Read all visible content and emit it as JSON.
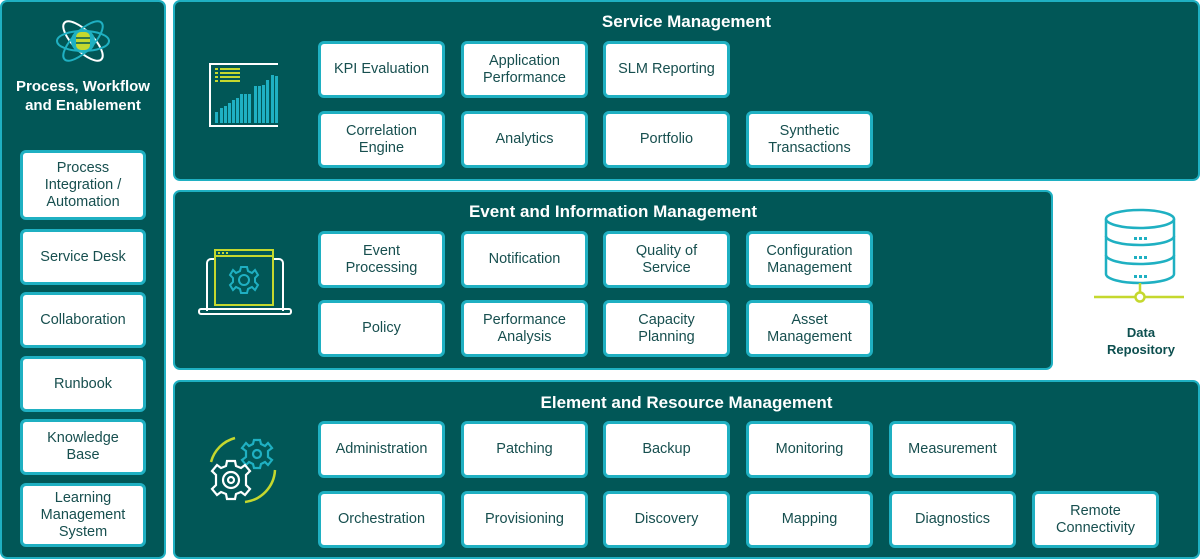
{
  "left_panel": {
    "title": "Process, Workflow\nand Enablement",
    "icon": "atom-database-icon",
    "items": [
      "Process\nIntegration /\nAutomation",
      "Service Desk",
      "Collaboration",
      "Runbook",
      "Knowledge\nBase",
      "Learning\nManagement\nSystem"
    ]
  },
  "service_management": {
    "title": "Service Management",
    "icon": "kpi-bar-chart-icon",
    "row1": [
      "KPI Evaluation",
      "Application\nPerformance",
      "SLM Reporting"
    ],
    "row2": [
      "Correlation\nEngine",
      "Analytics",
      "Portfolio",
      "Synthetic\nTransactions"
    ]
  },
  "event_management": {
    "title": "Event and Information Management",
    "icon": "laptop-gear-icon",
    "row1": [
      "Event\nProcessing",
      "Notification",
      "Quality of\nService",
      "Configuration\nManagement"
    ],
    "row2": [
      "Policy",
      "Performance\nAnalysis",
      "Capacity\nPlanning",
      "Asset\nManagement"
    ]
  },
  "element_management": {
    "title": "Element and Resource Management",
    "icon": "gears-icon",
    "row1": [
      "Administration",
      "Patching",
      "Backup",
      "Monitoring",
      "Measurement"
    ],
    "row2": [
      "Orchestration",
      "Provisioning",
      "Discovery",
      "Mapping",
      "Diagnostics",
      "Remote\nConnectivity"
    ]
  },
  "data_repository": {
    "label": "Data\nRepository",
    "icon": "database-network-icon"
  },
  "colors": {
    "panel_bg": "#015757",
    "accent_cyan": "#1fb0c2",
    "accent_lime": "#c5d82e",
    "text_dark": "#174f4f"
  }
}
